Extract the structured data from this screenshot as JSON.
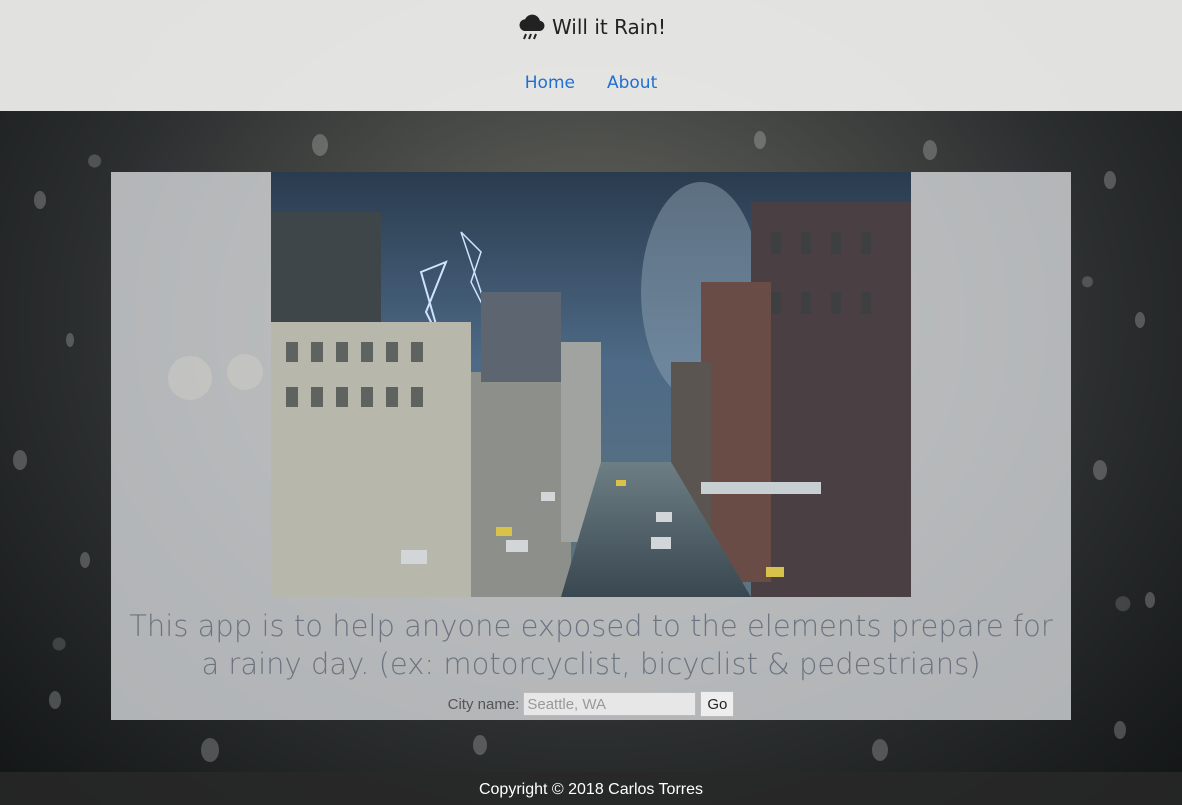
{
  "app": {
    "title": "Will it Rain!",
    "logo_icon": "rain-cloud-icon"
  },
  "nav": {
    "items": [
      {
        "label": "Home"
      },
      {
        "label": "About"
      }
    ],
    "link_color": "#1f6fd1"
  },
  "hero": {
    "image_description": "storm-city-image"
  },
  "main": {
    "tagline": "This app is to help anyone exposed to the elements prepare for a rainy day. (ex: motorcyclist, bicyclist & pedestrians)"
  },
  "form": {
    "label": "City name:",
    "input_value": "",
    "input_placeholder": "Seattle, WA",
    "submit_label": "Go"
  },
  "footer": {
    "copyright": "Copyright © 2018 Carlos Torres"
  }
}
